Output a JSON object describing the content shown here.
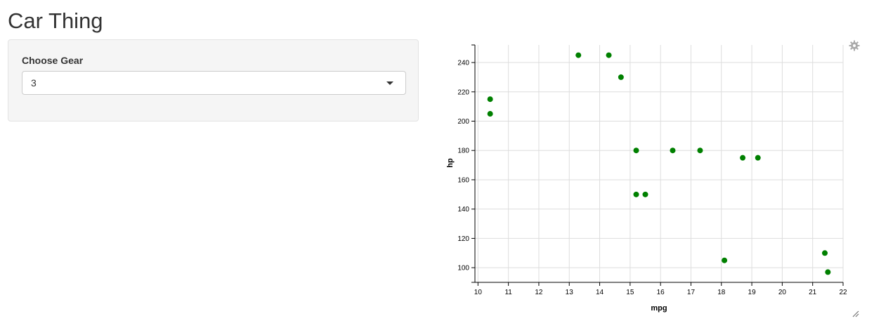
{
  "app": {
    "title": "Car Thing"
  },
  "sidebar": {
    "gear_label": "Choose Gear",
    "gear_selected": "3"
  },
  "colors": {
    "point": "#008000",
    "grid": "#dddddd",
    "axis": "#000000"
  },
  "icons": {
    "settings": "gear-icon",
    "select_caret": "caret-down-icon",
    "resize": "resize-handle-icon"
  },
  "chart_data": {
    "type": "scatter",
    "title": "",
    "xlabel": "mpg",
    "ylabel": "hp",
    "xlim": [
      9.9,
      22.0
    ],
    "ylim": [
      90,
      252
    ],
    "xticks": [
      10,
      11,
      12,
      13,
      14,
      15,
      16,
      17,
      18,
      19,
      20,
      21,
      22
    ],
    "yticks": [
      100,
      120,
      140,
      160,
      180,
      200,
      220,
      240
    ],
    "grid": true,
    "series": [
      {
        "points": [
          {
            "x": 10.4,
            "y": 215
          },
          {
            "x": 10.4,
            "y": 205
          },
          {
            "x": 13.3,
            "y": 245
          },
          {
            "x": 14.3,
            "y": 245
          },
          {
            "x": 14.7,
            "y": 230
          },
          {
            "x": 15.2,
            "y": 180
          },
          {
            "x": 15.2,
            "y": 150
          },
          {
            "x": 15.5,
            "y": 150
          },
          {
            "x": 16.4,
            "y": 180
          },
          {
            "x": 17.3,
            "y": 180
          },
          {
            "x": 18.1,
            "y": 105
          },
          {
            "x": 18.7,
            "y": 175
          },
          {
            "x": 19.2,
            "y": 175
          },
          {
            "x": 21.4,
            "y": 110
          },
          {
            "x": 21.5,
            "y": 97
          }
        ]
      }
    ]
  }
}
